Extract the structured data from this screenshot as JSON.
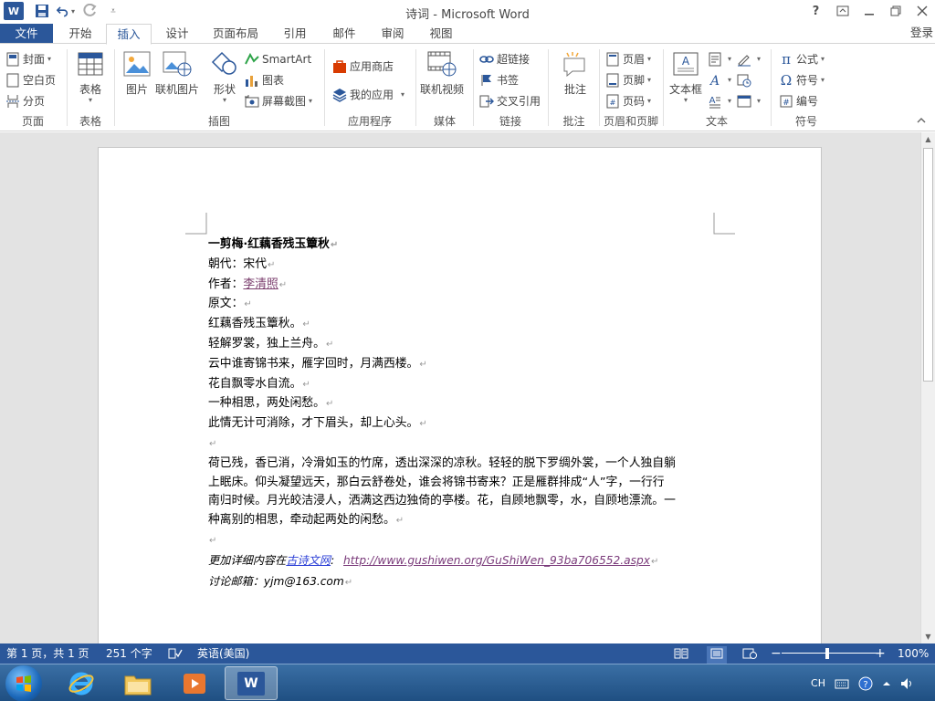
{
  "window": {
    "title": "诗词 - Microsoft Word",
    "help_glyph": "?",
    "login_label": "登录"
  },
  "tabs": [
    {
      "label": "文件"
    },
    {
      "label": "开始"
    },
    {
      "label": "插入"
    },
    {
      "label": "设计"
    },
    {
      "label": "页面布局"
    },
    {
      "label": "引用"
    },
    {
      "label": "邮件"
    },
    {
      "label": "审阅"
    },
    {
      "label": "视图"
    }
  ],
  "ribbon": {
    "pages": {
      "label": "页面",
      "cover": "封面",
      "blank": "空白页",
      "break": "分页"
    },
    "tables": {
      "label": "表格",
      "table": "表格"
    },
    "illustrations": {
      "label": "插图",
      "picture": "图片",
      "online_picture": "联机图片",
      "shapes": "形状",
      "smartart": "SmartArt",
      "chart": "图表",
      "screenshot": "屏幕截图"
    },
    "apps": {
      "label": "应用程序",
      "store": "应用商店",
      "my_apps": "我的应用"
    },
    "media": {
      "label": "媒体",
      "online_video": "联机视频"
    },
    "links": {
      "label": "链接",
      "hyperlink": "超链接",
      "bookmark": "书签",
      "crossref": "交叉引用"
    },
    "comments": {
      "label": "批注",
      "comment": "批注"
    },
    "header_footer": {
      "label": "页眉和页脚",
      "header": "页眉",
      "footer": "页脚",
      "page_number": "页码"
    },
    "text": {
      "label": "文本",
      "textbox": "文本框"
    },
    "symbols": {
      "label": "符号",
      "equation": "公式",
      "symbol": "符号",
      "number": "编号"
    }
  },
  "document": {
    "title": "一剪梅·红藕香残玉簟秋",
    "dynasty": "朝代：宋代",
    "author_prefix": "作者：",
    "author": "李清照",
    "original_label": "原文：",
    "poem_lines": [
      "红藕香残玉簟秋。",
      "轻解罗裳，独上兰舟。",
      "云中谁寄锦书来，雁字回时，月满西楼。",
      "花自飘零水自流。",
      "一种相思，两处闲愁。",
      "此情无计可消除，才下眉头，却上心头。"
    ],
    "translation_lines": [
      "荷已残，香已消，冷滑如玉的竹席，透出深深的凉秋。轻轻的脱下罗绸外裳，一个人独自躺",
      "上眠床。仰头凝望远天，那白云舒卷处，谁会将锦书寄来？正是雁群排成“人”字，一行行",
      "南归时候。月光皎洁浸人，洒满这西边独倚的亭楼。花，自顾地飘零，水，自顾地漂流。一",
      "种离别的相思，牵动起两处的闲愁。"
    ],
    "more_prefix": "更加详细内容在",
    "more_site": "古诗文网",
    "more_colon": ":",
    "more_url": "http://www.gushiwen.org/GuShiWen_93ba706552.aspx",
    "email_line": "讨论邮箱：yjm@163.com",
    "paragraph_mark": "↵"
  },
  "statusbar": {
    "page": "第 1 页，共 1 页",
    "words": "251 个字",
    "language": "英语(美国)",
    "zoom": "100%",
    "zoom_minus": "−",
    "zoom_plus": "+"
  },
  "taskbar": {
    "ime": "CH"
  },
  "colors": {
    "word_blue": "#2b579a",
    "doc_bg": "#e3e3e3"
  }
}
